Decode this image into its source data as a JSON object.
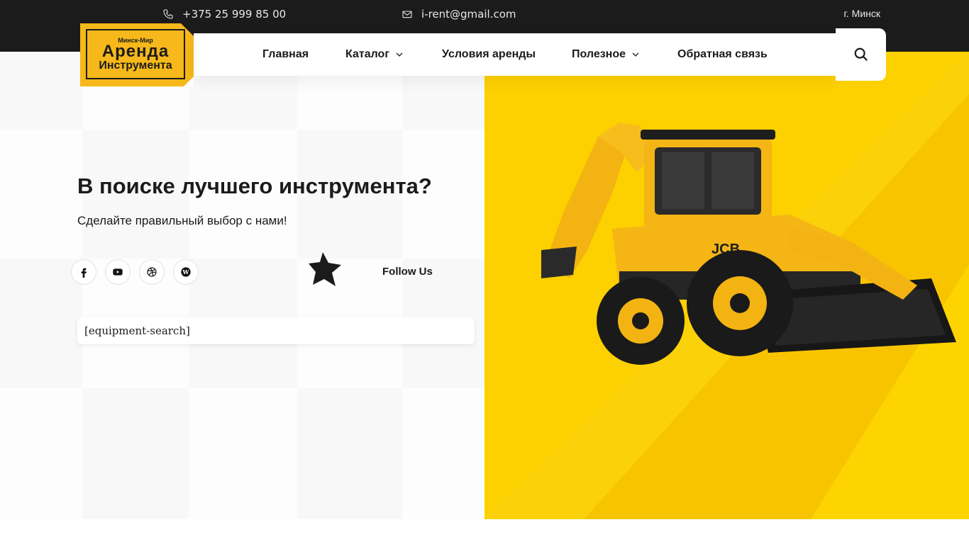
{
  "topbar": {
    "phone": "+375 25 999 85 00",
    "phone_icon": "phone-icon",
    "email": "i-rent@gmail.com",
    "email_icon": "mail-icon",
    "city": "г. Минск"
  },
  "logo": {
    "line1": "Минск-Мир",
    "line2": "Аренда",
    "line3": "Инструмента"
  },
  "nav": {
    "items": [
      {
        "label": "Главная",
        "has_dropdown": false
      },
      {
        "label": "Каталог",
        "has_dropdown": true
      },
      {
        "label": "Условия аренды",
        "has_dropdown": false
      },
      {
        "label": "Полезное",
        "has_dropdown": true
      },
      {
        "label": "Обратная связь",
        "has_dropdown": false
      }
    ],
    "search_icon": "search-icon"
  },
  "hero": {
    "title": "В поиске лучшего инструмента?",
    "subtitle": "Сделайте правильный выбор с нами!",
    "follow_label": "Follow Us",
    "search_placeholder": "[equipment-search]",
    "image": "backhoe-loader-jcb"
  },
  "social": [
    "facebook-icon",
    "youtube-icon",
    "dribbble-icon",
    "wordpress-icon"
  ],
  "colors": {
    "accent": "#fdd000",
    "logo_bg": "#f6b81a",
    "topbar_bg": "#1b1b1b"
  }
}
